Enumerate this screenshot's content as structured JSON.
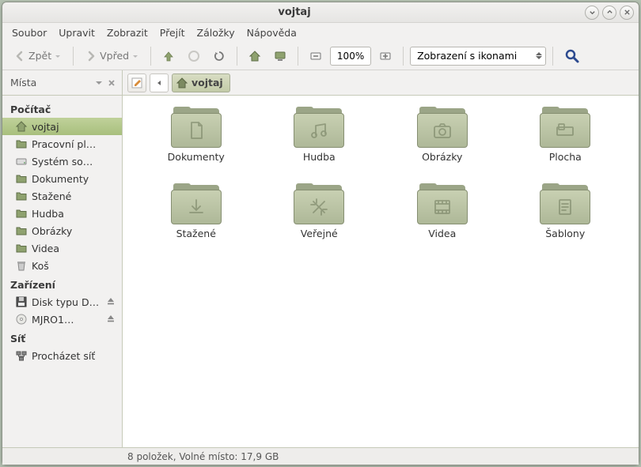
{
  "window": {
    "title": "vojtaj"
  },
  "menu": {
    "file": "Soubor",
    "edit": "Upravit",
    "view": "Zobrazit",
    "go": "Přejít",
    "bookmarks": "Záložky",
    "help": "Nápověda"
  },
  "toolbar": {
    "back": "Zpět",
    "forward": "Vpřed",
    "zoom": "100%",
    "view_mode": "Zobrazení s ikonami"
  },
  "sidebar": {
    "header": "Místa",
    "groups": [
      {
        "title": "Počítač",
        "items": [
          {
            "label": "vojtaj",
            "icon": "home",
            "selected": true
          },
          {
            "label": "Pracovní pl…",
            "icon": "folder"
          },
          {
            "label": "Systém so…",
            "icon": "drive"
          },
          {
            "label": "Dokumenty",
            "icon": "folder"
          },
          {
            "label": "Stažené",
            "icon": "folder"
          },
          {
            "label": "Hudba",
            "icon": "folder"
          },
          {
            "label": "Obrázky",
            "icon": "folder"
          },
          {
            "label": "Videa",
            "icon": "folder"
          },
          {
            "label": "Koš",
            "icon": "trash"
          }
        ]
      },
      {
        "title": "Zařízení",
        "items": [
          {
            "label": "Disk typu D…",
            "icon": "floppy",
            "eject": true
          },
          {
            "label": "MJRO1…",
            "icon": "cd",
            "eject": true
          }
        ]
      },
      {
        "title": "Síť",
        "items": [
          {
            "label": "Procházet síť",
            "icon": "network"
          }
        ]
      }
    ]
  },
  "breadcrumb": {
    "current": "vojtaj"
  },
  "folders": [
    {
      "label": "Dokumenty",
      "glyph": "document"
    },
    {
      "label": "Hudba",
      "glyph": "music"
    },
    {
      "label": "Obrázky",
      "glyph": "camera"
    },
    {
      "label": "Plocha",
      "glyph": "desktop"
    },
    {
      "label": "Stažené",
      "glyph": "download"
    },
    {
      "label": "Veřejné",
      "glyph": "public"
    },
    {
      "label": "Videa",
      "glyph": "video"
    },
    {
      "label": "Šablony",
      "glyph": "template"
    }
  ],
  "statusbar": {
    "text": "8 položek, Volné místo: 17,9 GB"
  }
}
